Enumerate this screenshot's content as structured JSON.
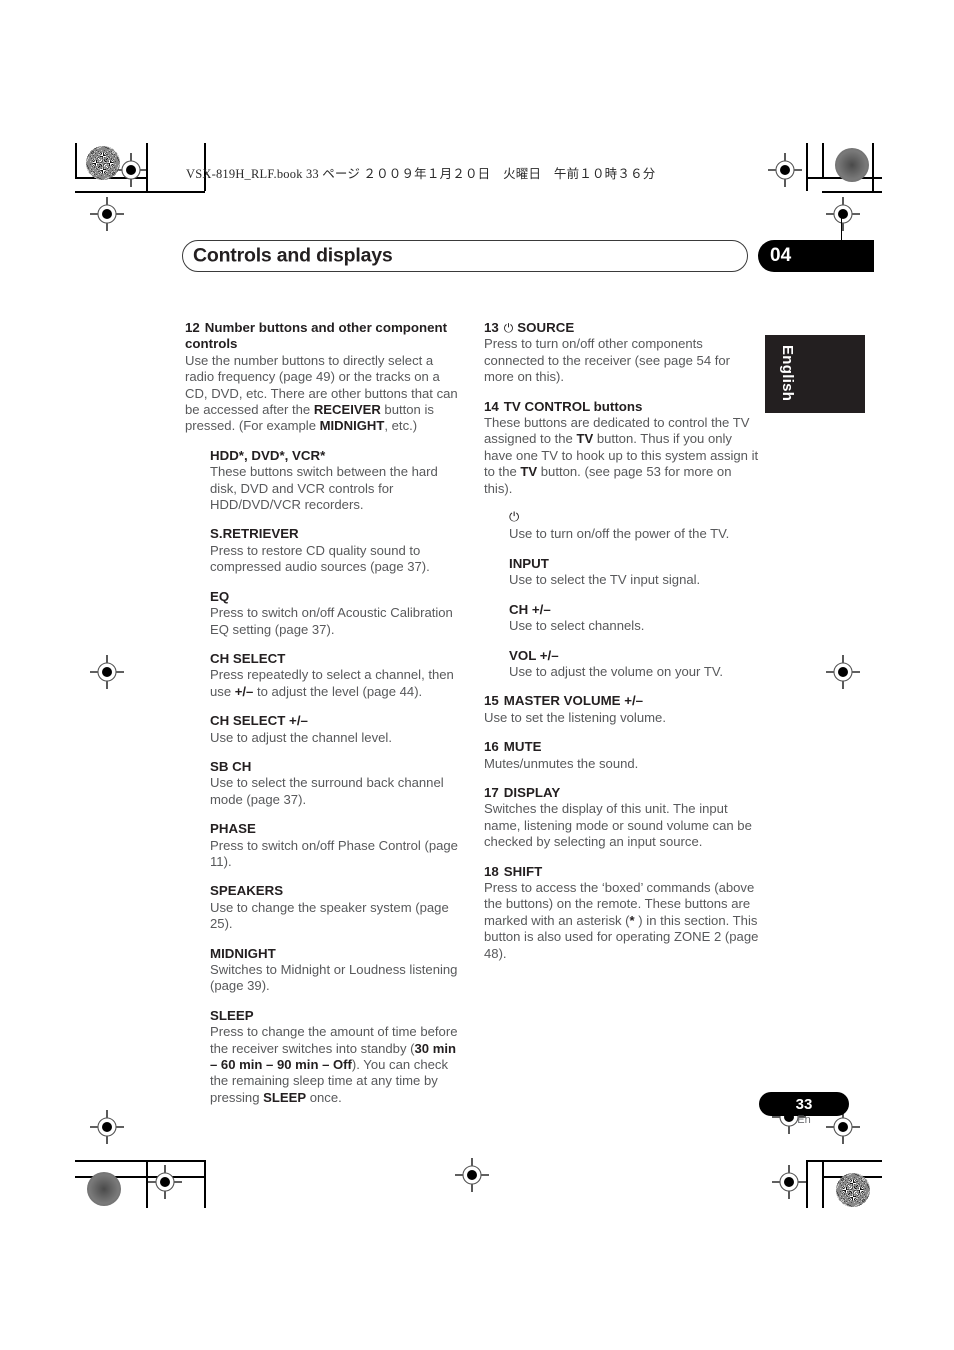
{
  "document": {
    "book_header": "VSX-819H_RLF.book   33 ページ   ２００９年１月２０日　火曜日　午前１０時３６分",
    "chapter_title": "Controls and displays",
    "chapter_number": "04",
    "language_tab": "English",
    "page_number": "33",
    "page_language_code": "En"
  },
  "left_column": {
    "item12": {
      "number": "12",
      "heading": "Number buttons and other component controls",
      "body_1": "Use the number buttons to directly select a radio frequency (page 49) or the tracks on a CD, DVD, etc. There are other buttons that can be accessed after the ",
      "bold_1": "RECEIVER",
      "body_2": " button is pressed. (For example ",
      "bold_2": "MIDNIGHT",
      "body_3": ", etc.)"
    },
    "sub_hdd": {
      "heading": "HDD*, DVD*, VCR*",
      "body": "These buttons switch between the hard disk, DVD and VCR controls for HDD/DVD/VCR recorders."
    },
    "sub_sretriever": {
      "heading": "S.RETRIEVER",
      "body": "Press to restore CD quality sound to compressed audio sources (page 37)."
    },
    "sub_eq": {
      "heading": "EQ",
      "body": "Press to switch on/off Acoustic Calibration EQ setting (page 37)."
    },
    "sub_chselect": {
      "heading": "CH SELECT",
      "body_1": "Press repeatedly to select a channel, then use ",
      "bold_1": "+/–",
      "body_2": " to adjust the level (page 44)."
    },
    "sub_chselect_pm": {
      "heading": "CH SELECT +/–",
      "body": "Use to adjust the channel level."
    },
    "sub_sbch": {
      "heading": "SB CH",
      "body": "Use to select the surround back channel mode (page 37)."
    },
    "sub_phase": {
      "heading": "PHASE",
      "body": "Press to switch on/off Phase Control (page 11)."
    },
    "sub_speakers": {
      "heading": "SPEAKERS",
      "body": "Use to change the speaker system (page 25)."
    },
    "sub_midnight": {
      "heading": "MIDNIGHT",
      "body": "Switches to Midnight or Loudness listening (page 39)."
    },
    "sub_sleep": {
      "heading": "SLEEP",
      "body_1": "Press to change the amount of time before the receiver switches into standby (",
      "bold_1": "30 min – 60 min – 90 min – Off",
      "body_2": "). You can check the remaining sleep time at any time by pressing ",
      "bold_2": "SLEEP",
      "body_3": " once."
    }
  },
  "right_column": {
    "item13": {
      "number": "13",
      "power_icon": "power-icon",
      "heading": "SOURCE",
      "body": "Press to turn on/off other components connected to the receiver (see page 54 for more on this)."
    },
    "item14": {
      "number": "14",
      "heading": "TV CONTROL buttons",
      "body_1": "These buttons are dedicated to control the TV assigned to the ",
      "bold_1": "TV",
      "body_2": " button. Thus if you only have one TV to hook up to this system assign it to the ",
      "bold_2": "TV",
      "body_3": " button. (see page 53 for more on this)."
    },
    "sub_power": {
      "heading_icon": "power-icon",
      "body": "Use to turn on/off the power of the TV."
    },
    "sub_input": {
      "heading": "INPUT",
      "body": "Use to select the TV input signal."
    },
    "sub_ch": {
      "heading": "CH +/–",
      "body": "Use to select channels."
    },
    "sub_vol": {
      "heading": "VOL +/–",
      "body": "Use to adjust the volume on your TV."
    },
    "item15": {
      "number": "15",
      "heading": "MASTER VOLUME +/–",
      "body": "Use to set the listening volume."
    },
    "item16": {
      "number": "16",
      "heading": "MUTE",
      "body": "Mutes/unmutes the sound."
    },
    "item17": {
      "number": "17",
      "heading": "DISPLAY",
      "body": "Switches the display of this unit. The input name, listening mode or sound volume can be checked by selecting an input source."
    },
    "item18": {
      "number": "18",
      "heading": "SHIFT",
      "body_1": "Press to access the ‘boxed’ commands (above the buttons) on the remote. These buttons are marked with an asterisk (",
      "bold_1": "*",
      "body_2": " ) in this section. This button is also used for operating ZONE 2 (page 48)."
    }
  }
}
